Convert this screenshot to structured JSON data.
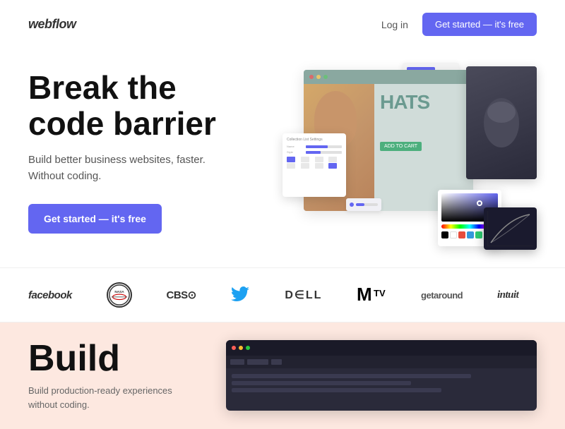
{
  "header": {
    "logo": "webflow",
    "login_label": "Log in",
    "cta_label": "Get started — it's free"
  },
  "hero": {
    "title_line1": "Break the",
    "title_line2": "code barrier",
    "subtitle_line1": "Build better business websites, faster.",
    "subtitle_line2": "Without coding.",
    "cta_label": "Get started — it's free"
  },
  "brands": [
    {
      "name": "facebook",
      "display": "facebook",
      "type": "text"
    },
    {
      "name": "nasa",
      "display": "NASA",
      "type": "circle"
    },
    {
      "name": "cbs",
      "display": "CBS⊙",
      "type": "text"
    },
    {
      "name": "twitter",
      "display": "🐦",
      "type": "bird"
    },
    {
      "name": "dell",
      "display": "D∈LL",
      "type": "text"
    },
    {
      "name": "mtv",
      "display": "MTV",
      "type": "text"
    },
    {
      "name": "getaround",
      "display": "getaround",
      "type": "text"
    },
    {
      "name": "intuit",
      "display": "intuit",
      "type": "text"
    }
  ],
  "build_section": {
    "title": "Build",
    "subtitle_line1": "Build production-ready experiences",
    "subtitle_line2": "without coding."
  },
  "colors": {
    "accent": "#6366f1",
    "hero_bg": "#fff",
    "build_bg": "#fde8e0",
    "brand_bar_bg": "#f8f8f8"
  }
}
